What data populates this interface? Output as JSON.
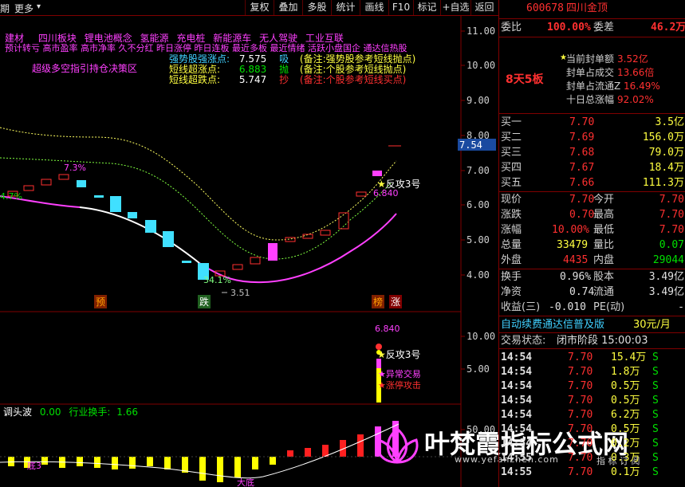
{
  "toolbar": {
    "left_label": "期",
    "more": "更多",
    "buttons": [
      "复权",
      "叠加",
      "多股",
      "统计",
      "画线",
      "F10",
      "标记",
      "+自选",
      "返回"
    ]
  },
  "overlay": {
    "line1": [
      "建材",
      "四川板块",
      "锂电池概念",
      "氢能源",
      "充电桩",
      "新能源车",
      "无人驾驶",
      "工业互联"
    ],
    "line2": "预计转亏 高市盈率 高市净率 久不分红 昨日涨停 昨日连板 最近多板 最近情绪 活跃小盘国企 通达信热股",
    "line3_label": "超级多空指引持仓决策区",
    "legend": [
      {
        "name": "强势股强涨点:",
        "value": "7.575",
        "tag": "吸",
        "note": "(备注:强势股参考短线抛点)"
      },
      {
        "name": "短线超涨点:",
        "value": "6.883",
        "tag": "抛",
        "note": "(备注:个股参考短线抛点)"
      },
      {
        "name": "短线超跌点:",
        "value": "5.747",
        "tag": "抄",
        "note": "(备注:个股参考短线买点)"
      }
    ]
  },
  "price_axis": [
    "11.00",
    "10.00",
    "9.00",
    "8.00",
    "7.00",
    "6.00",
    "5.00",
    "4.00"
  ],
  "price_marker": "7.54",
  "chart_labels": {
    "pct_a": "7.3%",
    "pct_b": "4.7%",
    "pct_c": "34.1%",
    "low": "3.51",
    "high": "6.840",
    "fangong": "反攻3号",
    "yu": "预",
    "die": "跌",
    "bang": "榜",
    "zhang": "涨"
  },
  "volume_axis": [
    "10.00",
    "5.00"
  ],
  "volume_labels": {
    "top": "6.840",
    "fangong": "反攻3号",
    "abnormal": "异常交易",
    "limit": "涨停攻击"
  },
  "indicator": {
    "name": "调头波",
    "value": "0.00",
    "turnover_label": "行业换手:",
    "turnover_value": "1.66",
    "axis_top": "50.00",
    "label_a": "底3",
    "label_b": "大底"
  },
  "watermark": {
    "title": "叶梵霞指标公式网",
    "url": "www.yefanzhen.com",
    "sub": "指 标 订 阅"
  },
  "quote": {
    "code": "600678",
    "name": "四川金顶",
    "weibi_label": "委比",
    "weibi_value": "100.00%",
    "weicha_label": "委差",
    "weicha_value": "46.2万",
    "limit_info": [
      {
        "label": "当前封单额",
        "value": "3.52亿"
      },
      {
        "label": "封单占成交",
        "value": "13.66倍"
      },
      {
        "label": "封单占流通Z",
        "value": "16.49%"
      },
      {
        "label": "十日总涨幅",
        "value": "92.02%"
      }
    ],
    "streak": "8天5板",
    "bids": [
      {
        "label": "买一",
        "price": "7.70",
        "vol": "3.5亿"
      },
      {
        "label": "买二",
        "price": "7.69",
        "vol": "156.0万"
      },
      {
        "label": "买三",
        "price": "7.68",
        "vol": "79.0万"
      },
      {
        "label": "买四",
        "price": "7.67",
        "vol": "18.4万"
      },
      {
        "label": "买五",
        "price": "7.66",
        "vol": "111.3万"
      }
    ],
    "stats": [
      {
        "l1": "现价",
        "v1": "7.70",
        "l2": "今开",
        "v2": "7.70"
      },
      {
        "l1": "涨跌",
        "v1": "0.70",
        "l2": "最高",
        "v2": "7.70"
      },
      {
        "l1": "涨幅",
        "v1": "10.00%",
        "l2": "最低",
        "v2": "7.70"
      },
      {
        "l1": "总量",
        "v1": "33479",
        "l2": "量比",
        "v2": "0.07"
      },
      {
        "l1": "外盘",
        "v1": "4435",
        "l2": "内盘",
        "v2": "29044"
      }
    ],
    "stats2": [
      {
        "l1": "换手",
        "v1": "0.96%",
        "l2": "股本",
        "v2": "3.49亿"
      },
      {
        "l1": "净资",
        "v1": "0.74",
        "l2": "流通",
        "v2": "3.49亿"
      },
      {
        "l1": "收益(三)",
        "v1": "-0.010",
        "l2": "PE(动)",
        "v2": "-"
      }
    ],
    "promo": "自动续费通达信普及版",
    "promo_price": "30元/月",
    "trade_state_label": "交易状态:",
    "trade_state": "闭市阶段 15:00:03",
    "ticks": [
      {
        "t": "14:54",
        "p": "7.70",
        "v": "15.4万",
        "s": "S"
      },
      {
        "t": "14:54",
        "p": "7.70",
        "v": "1.8万",
        "s": "S"
      },
      {
        "t": "14:54",
        "p": "7.70",
        "v": "0.5万",
        "s": "S"
      },
      {
        "t": "14:54",
        "p": "7.70",
        "v": "0.5万",
        "s": "S"
      },
      {
        "t": "14:54",
        "p": "7.70",
        "v": "6.2万",
        "s": "S"
      },
      {
        "t": "14:54",
        "p": "7.70",
        "v": "0.5万",
        "s": "S"
      },
      {
        "t": "14:54",
        "p": "7.70",
        "v": "0.2万",
        "s": "S"
      },
      {
        "t": "14:55",
        "p": "7.70",
        "v": "0.3万",
        "s": "S"
      },
      {
        "t": "14:55",
        "p": "7.70",
        "v": "0.1万",
        "s": "S"
      }
    ]
  }
}
